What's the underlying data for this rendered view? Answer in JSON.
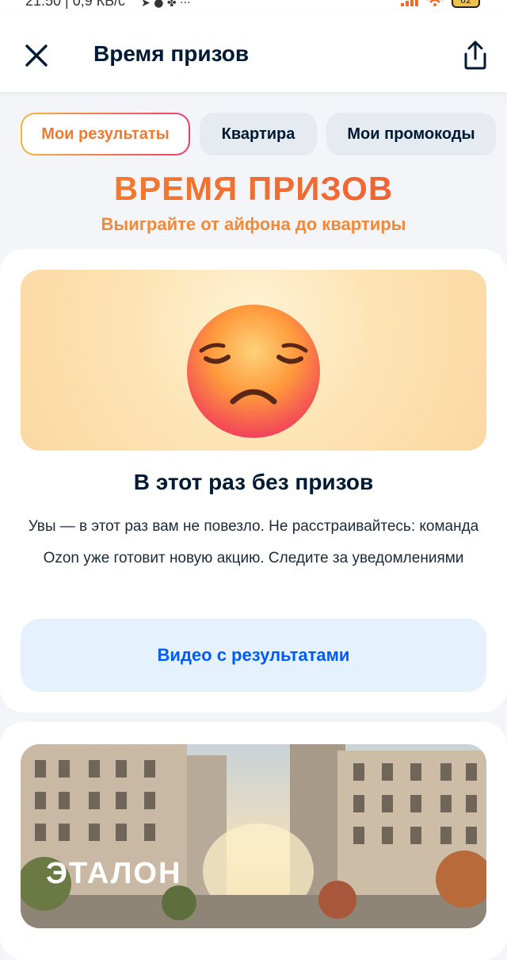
{
  "status_bar": {
    "time_speed": "21:50 | 0,9 КБ/с",
    "more": "···",
    "battery": "62",
    "colors": {
      "signal": "#ee6a2a",
      "battery_fill": "#f1c24a"
    }
  },
  "header": {
    "title": "Время призов",
    "close_icon": "close-icon",
    "share_icon": "share-icon"
  },
  "tabs": [
    {
      "label": "Мои результаты",
      "active": true
    },
    {
      "label": "Квартира",
      "active": false
    },
    {
      "label": "Мои промокоды",
      "active": false
    }
  ],
  "hero": {
    "title": "ВРЕМЯ ПРИЗОВ",
    "subtitle": "Выиграйте от айфона до квартиры"
  },
  "result": {
    "title": "В этот раз без призов",
    "text": "Увы — в этот раз вам не повезло. Не расстраивайтесь: команда Ozon уже готовит новую акцию. Следите за уведомлениями",
    "video_button": "Видео с результатами",
    "emoji_icon": "pensive-face-icon"
  },
  "promo": {
    "brand": "ЭТАЛОН"
  },
  "colors": {
    "accent_orange": "#f3832d",
    "link_blue": "#005bff",
    "text_dark": "#001a34",
    "button_bg": "#e5f2fd"
  }
}
